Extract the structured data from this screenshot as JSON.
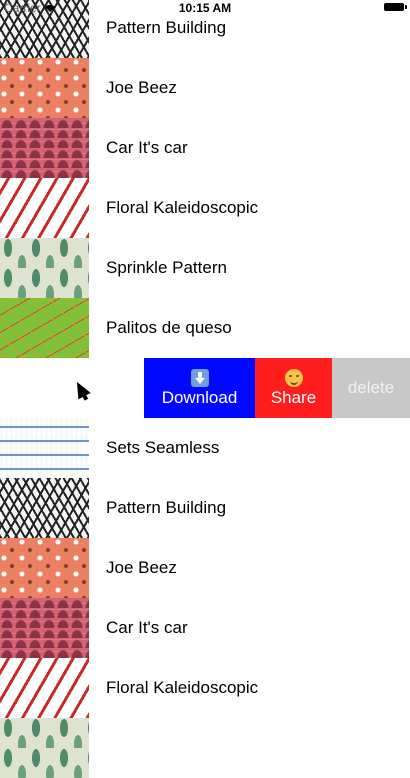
{
  "status_bar": {
    "carrier": "Carrier",
    "time": "10:15 AM"
  },
  "rows_top": [
    {
      "title": "Pattern Building"
    },
    {
      "title": "Joe Beez"
    },
    {
      "title": "Car It's car"
    },
    {
      "title": "Floral Kaleidoscopic"
    },
    {
      "title": "Sprinkle Pattern"
    },
    {
      "title": "Palitos de queso"
    }
  ],
  "swipe_actions": {
    "download": {
      "label": "Download",
      "icon": "inbox-tray-icon"
    },
    "share": {
      "label": "Share",
      "icon": "hugging-face-icon"
    },
    "delete": {
      "label": "delete"
    }
  },
  "rows_bottom": [
    {
      "title": "Sets Seamless"
    },
    {
      "title": "Pattern Building"
    },
    {
      "title": "Joe Beez"
    },
    {
      "title": "Car It's car"
    },
    {
      "title": "Floral Kaleidoscopic"
    },
    {
      "title": ""
    }
  ],
  "colors": {
    "download": "#0008ff",
    "share": "#ff1d1d",
    "delete": "#c8c8c8"
  }
}
